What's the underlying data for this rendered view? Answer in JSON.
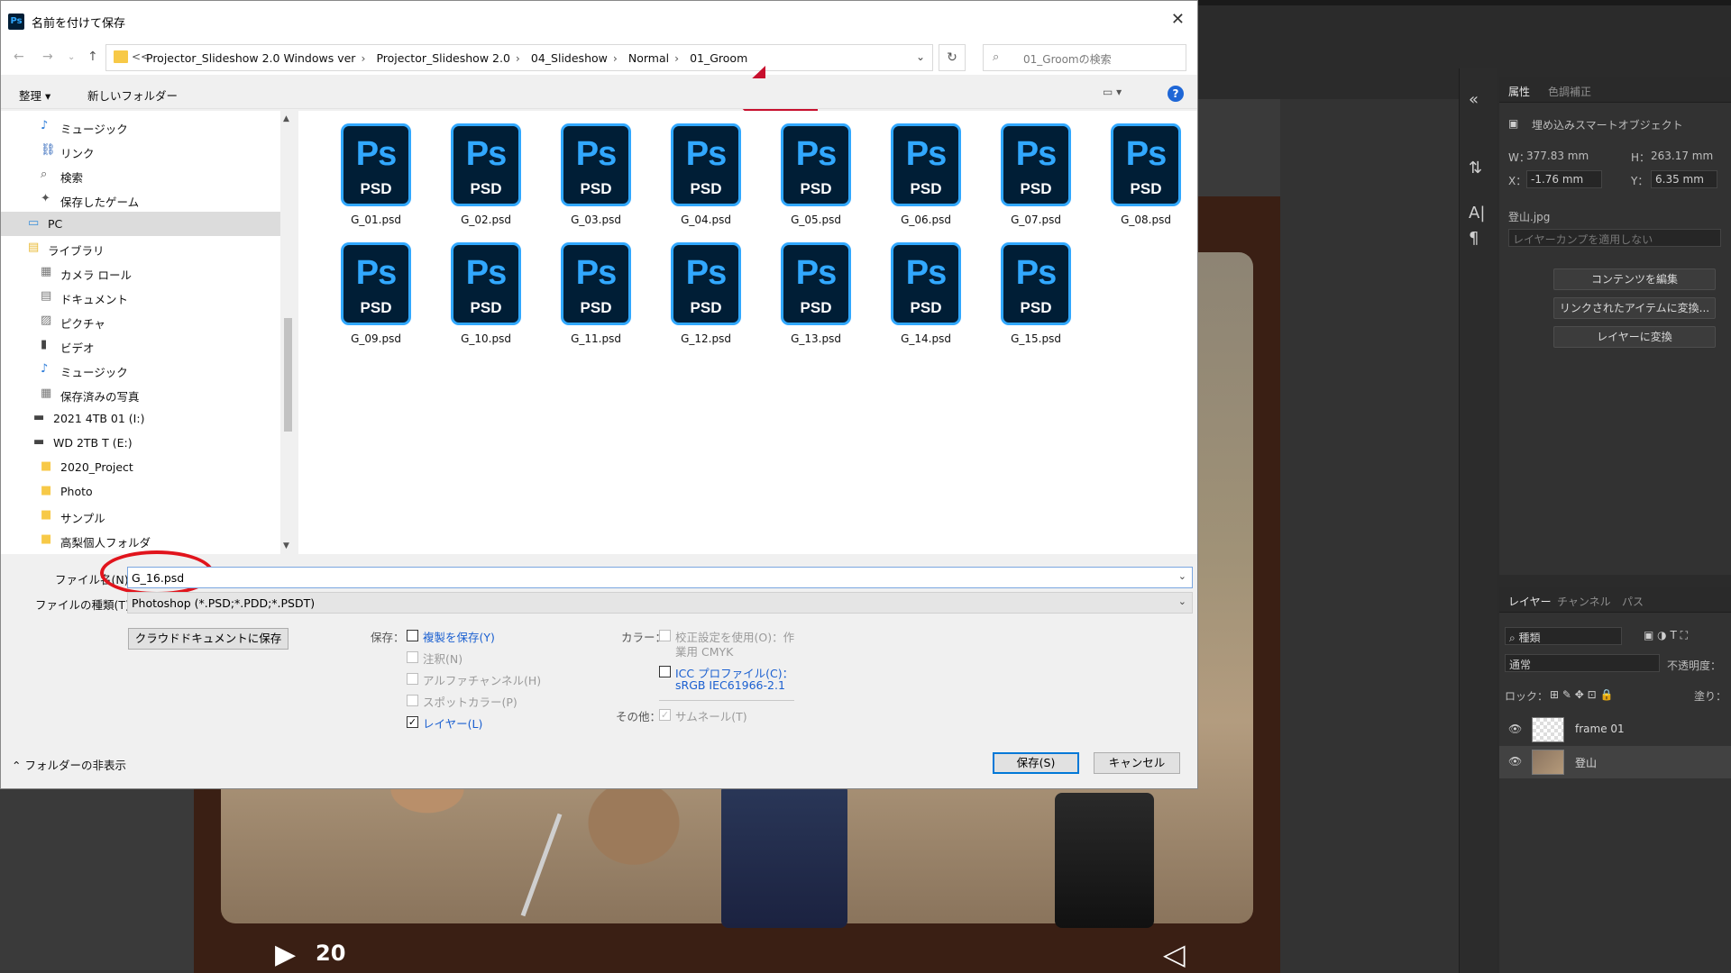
{
  "dialog": {
    "title": "名前を付けて保存",
    "badge": "Ps",
    "address": {
      "back_arrow": "<<",
      "crumbs": [
        "Projector_Slideshow 2.0 Windows ver",
        "Projector_Slideshow 2.0",
        "04_Slideshow",
        "Normal",
        "01_Groom"
      ],
      "search_placeholder": "01_Groomの検索"
    },
    "toolbar": {
      "organize": "整理 ▾",
      "new_folder": "新しいフォルダー",
      "help": "?"
    },
    "nav": [
      {
        "label": "ミュージック",
        "icon": "music-icon"
      },
      {
        "label": "リンク",
        "icon": "link-icon"
      },
      {
        "label": "検索",
        "icon": "search-icon"
      },
      {
        "label": "保存したゲーム",
        "icon": "game-icon"
      },
      {
        "label": "PC",
        "icon": "pc-icon"
      },
      {
        "label": "ライブラリ",
        "icon": "library-icon"
      },
      {
        "label": "カメラ ロール",
        "icon": "camera-roll-icon"
      },
      {
        "label": "ドキュメント",
        "icon": "document-icon"
      },
      {
        "label": "ピクチャ",
        "icon": "picture-icon"
      },
      {
        "label": "ビデオ",
        "icon": "video-icon"
      },
      {
        "label": "ミュージック",
        "icon": "music-icon"
      },
      {
        "label": "保存済みの写真",
        "icon": "photo-icon"
      },
      {
        "label": "2021 4TB 01 (I:)",
        "icon": "drive-icon"
      },
      {
        "label": "WD 2TB T (E:)",
        "icon": "drive-icon"
      },
      {
        "label": "2020_Project",
        "icon": "folder-icon"
      },
      {
        "label": "Photo",
        "icon": "folder-icon"
      },
      {
        "label": "サンプル",
        "icon": "folder-icon"
      },
      {
        "label": "高梨個人フォルダ",
        "icon": "folder-icon"
      }
    ],
    "files": {
      "icon_top": "Ps",
      "icon_bottom": "PSD",
      "names": [
        "G_01.psd",
        "G_02.psd",
        "G_03.psd",
        "G_04.psd",
        "G_05.psd",
        "G_06.psd",
        "G_07.psd",
        "G_08.psd",
        "G_09.psd",
        "G_10.psd",
        "G_11.psd",
        "G_12.psd",
        "G_13.psd",
        "G_14.psd",
        "G_15.psd"
      ]
    },
    "form": {
      "filename_label": "ファイル名(N):",
      "filename_value": "G_16.psd",
      "filetype_label": "ファイルの種類(T):",
      "filetype_value": "Photoshop (*.PSD;*.PDD;*.PSDT)",
      "cloud_button": "クラウドドキュメントに保存",
      "save_label": "保存：",
      "color_label": "カラー：",
      "other_label": "その他：",
      "opt_copy": "複製を保存(Y)",
      "opt_notes": "注釈(N)",
      "opt_alpha": "アルファチャンネル(H)",
      "opt_spot": "スポットカラー(P)",
      "opt_layers": "レイヤー(L)",
      "opt_proof_line1": "校正設定を使用(O)：作",
      "opt_proof_line2": "業用 CMYK",
      "opt_icc_line1": "ICC プロファイル(C)：",
      "opt_icc_line2": "sRGB IEC61966-2.1",
      "opt_thumb": "サムネール(T)",
      "hide_folders": "フォルダーの非表示",
      "save_button": "保存(S)",
      "cancel_button": "キャンセル"
    }
  },
  "photoshop": {
    "properties_tab": "属性",
    "adjust_tab": "色調補正",
    "smart_object": "埋め込みスマートオブジェクト",
    "w_label": "W：",
    "w_value": "377.83 mm",
    "h_label": "H：",
    "h_value": "263.17 mm",
    "x_label": "X：",
    "x_value": "-1.76 mm",
    "y_label": "Y：",
    "y_value": "6.35 mm",
    "source_file": "登山.jpg",
    "layer_comp": "レイヤーカンプを適用しない",
    "btn_edit": "コンテンツを編集",
    "btn_convert_linked": "リンクされたアイテムに変換...",
    "btn_convert_layers": "レイヤーに変換",
    "layers_tab": "レイヤー",
    "channels_tab": "チャンネル",
    "paths_tab": "パス",
    "filter_kind": "種類",
    "blend_mode": "通常",
    "opacity_label": "不透明度：",
    "lock_label": "ロック：",
    "fill_label": "塗り：",
    "layers": [
      "frame 01",
      "登山"
    ],
    "slide_number": "20"
  },
  "colors": {
    "accent_red": "#e1141c",
    "ps_blue": "#31a8ff",
    "ps_navy": "#001e36",
    "link_blue": "#1a5fd0"
  }
}
